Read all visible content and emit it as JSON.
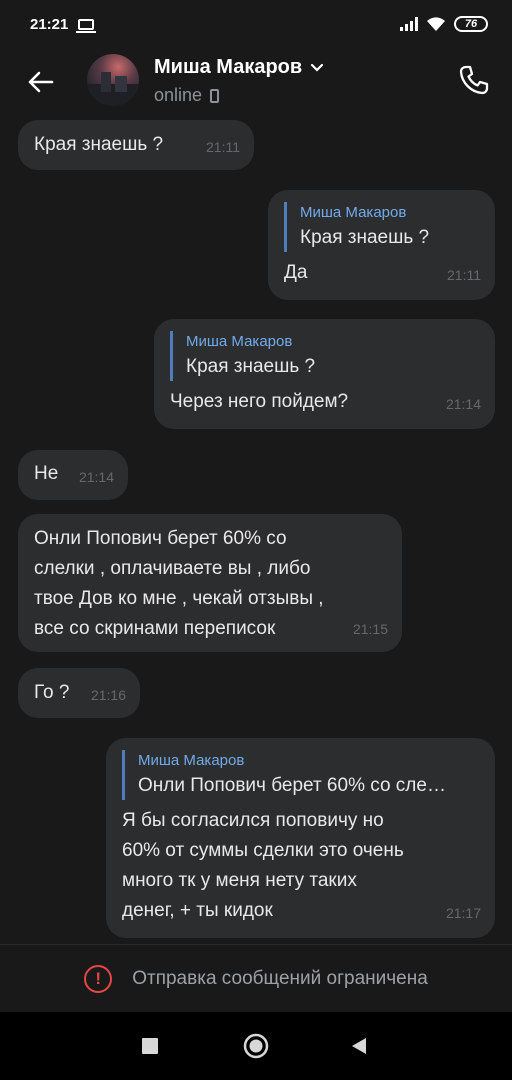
{
  "status_bar": {
    "time": "21:21",
    "battery": "76"
  },
  "header": {
    "contact_name": "Миша Макаров",
    "contact_status": "online"
  },
  "messages": [
    {
      "side": "in",
      "text": "Края знаешь ?",
      "time": "21:11"
    },
    {
      "side": "out",
      "reply_author": "Миша Макаров",
      "reply_text": "Края знаешь ?",
      "text": "Да",
      "time": "21:11"
    },
    {
      "side": "out",
      "reply_author": "Миша Макаров",
      "reply_text": "Края знаешь ?",
      "text": "Через него пойдем?",
      "time": "21:14"
    },
    {
      "side": "in",
      "text": "Не",
      "time": "21:14"
    },
    {
      "side": "in",
      "text": "Онли Попович берет 60% со\nслелки , оплачиваете вы , либо\nтвое Дов ко мне , чекай отзывы ,\nвсе со скринами переписок",
      "time": "21:15"
    },
    {
      "side": "in",
      "text": "Го ?",
      "time": "21:16"
    },
    {
      "side": "out",
      "reply_author": "Миша Макаров",
      "reply_text": "Онли Попович берет 60% со сле…",
      "text": "Я бы согласился поповичу но\n60% от суммы сделки это очень\nмного тк у меня нету таких\nденег, + ты кидок",
      "time": "21:17"
    }
  ],
  "restriction": {
    "text": "Отправка сообщений ограничена"
  },
  "colors": {
    "background": "#19191a",
    "bubble": "#2c2d2f",
    "reply_accent": "#71aaeb",
    "warning": "#e64646"
  }
}
